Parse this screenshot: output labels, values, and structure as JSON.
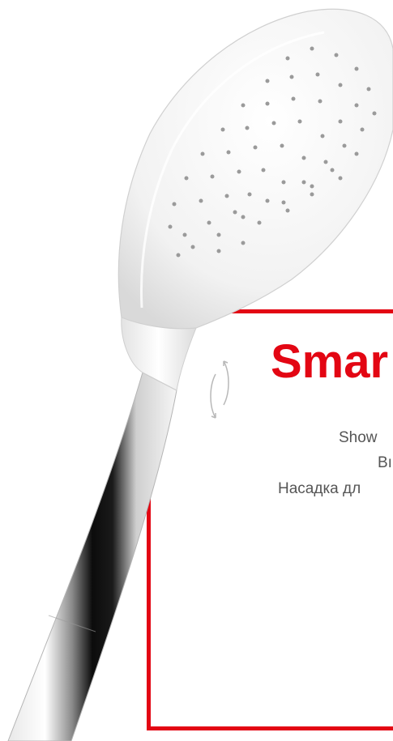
{
  "product": {
    "title": "Smar",
    "lines": [
      "Show",
      "Bı",
      "Насадка дл"
    ]
  },
  "icons": {
    "rotate": "rotate-arrows-icon"
  },
  "colors": {
    "accent": "#e30613",
    "text": "#555555",
    "background": "#ffffff",
    "showerhead": "#f4f4f4"
  }
}
